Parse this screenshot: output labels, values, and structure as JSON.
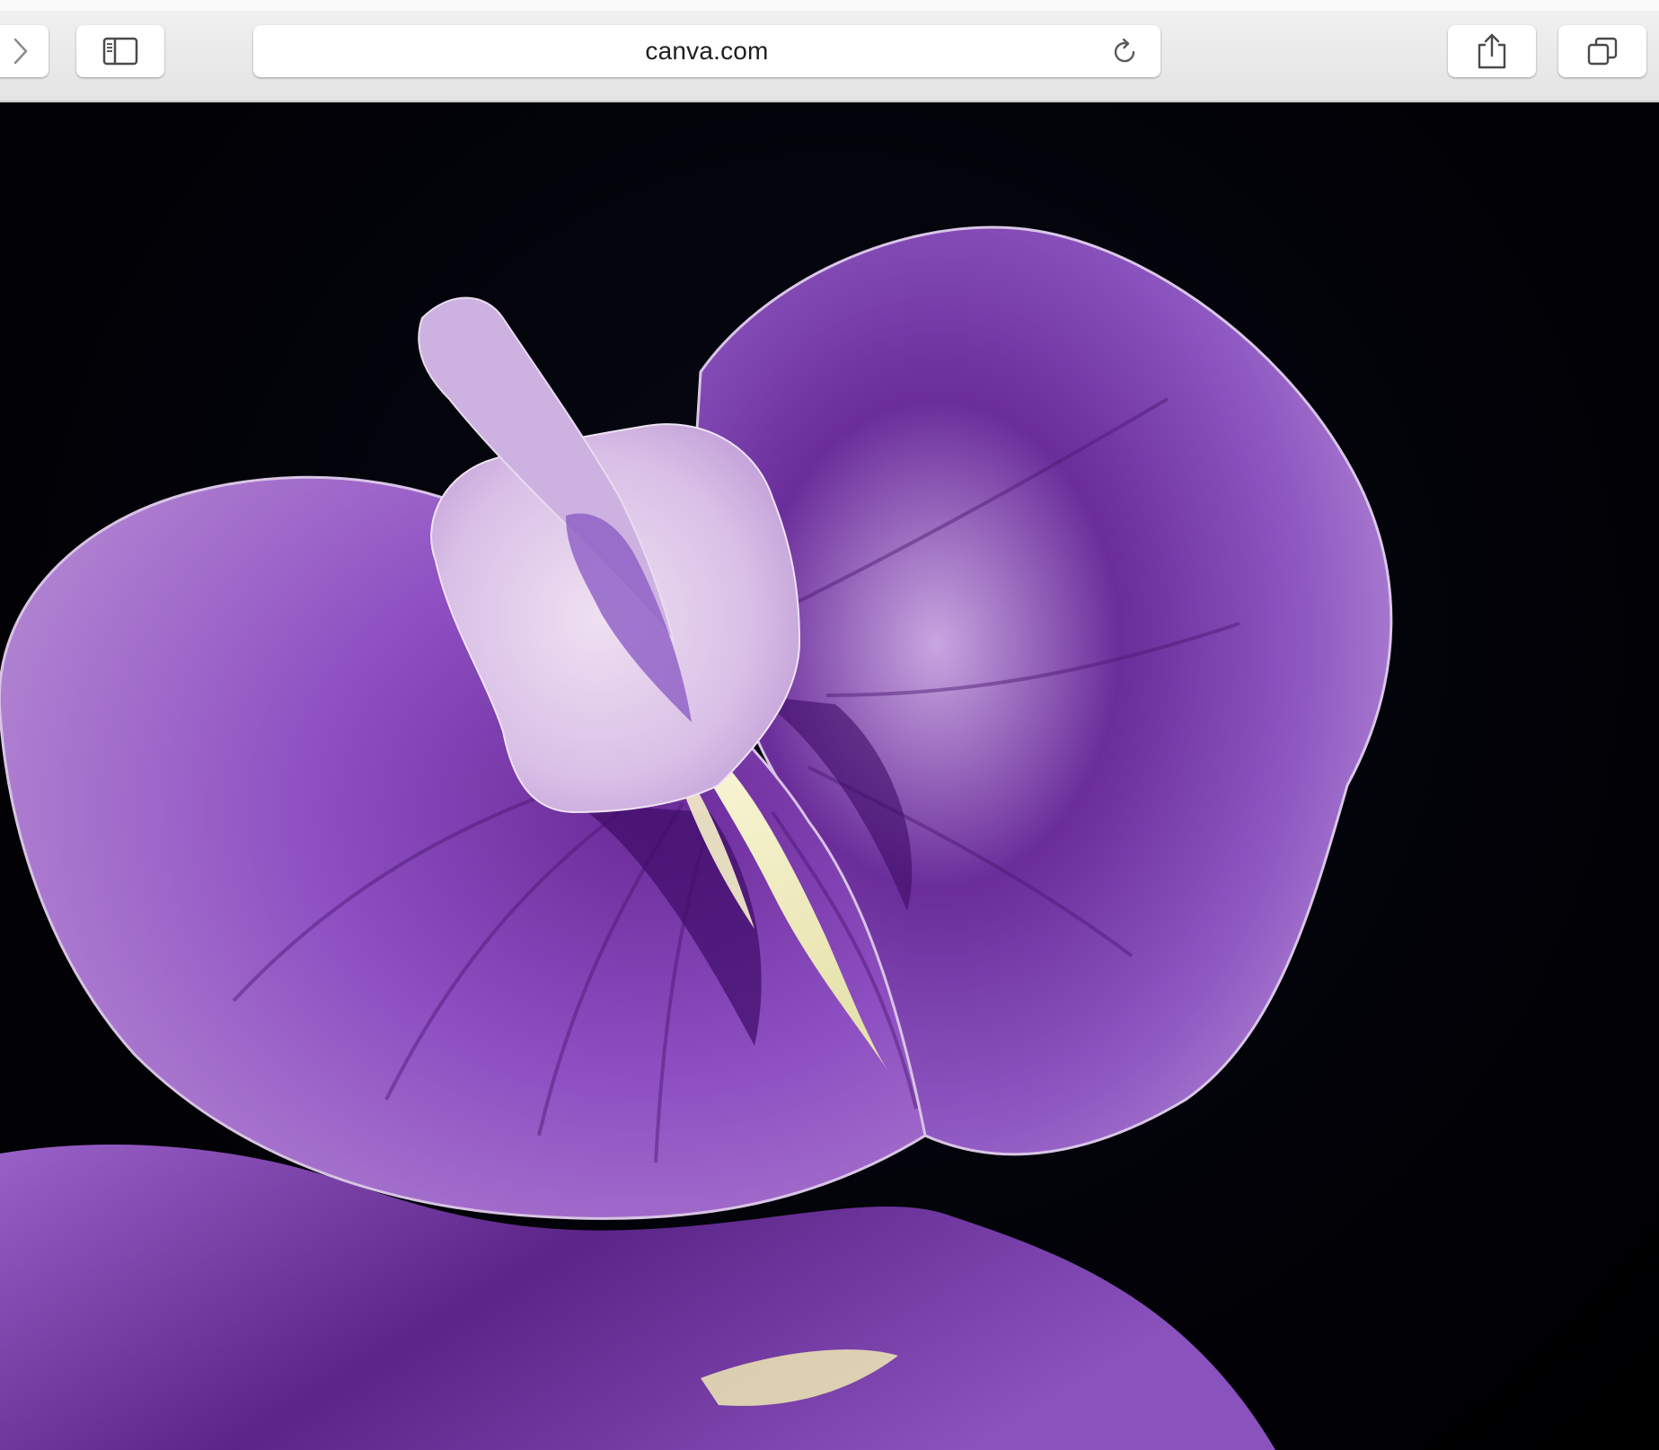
{
  "browser": {
    "address": "canva.com",
    "buttons": {
      "forward_icon": "chevron-right-icon",
      "sidebar_icon": "sidebar-icon",
      "reload_icon": "reload-icon",
      "share_icon": "share-icon",
      "tabs_icon": "tabs-icon"
    }
  },
  "content": {
    "subject": "photo-of-purple-flower",
    "colors": {
      "background": "#000000",
      "petal_deep": "#5a2a88",
      "petal_mid": "#8b4fc0",
      "petal_light": "#c7a3e0",
      "keel": "#e9d6ee",
      "center_cream": "#f1eec2",
      "vein": "#4b1670"
    }
  }
}
